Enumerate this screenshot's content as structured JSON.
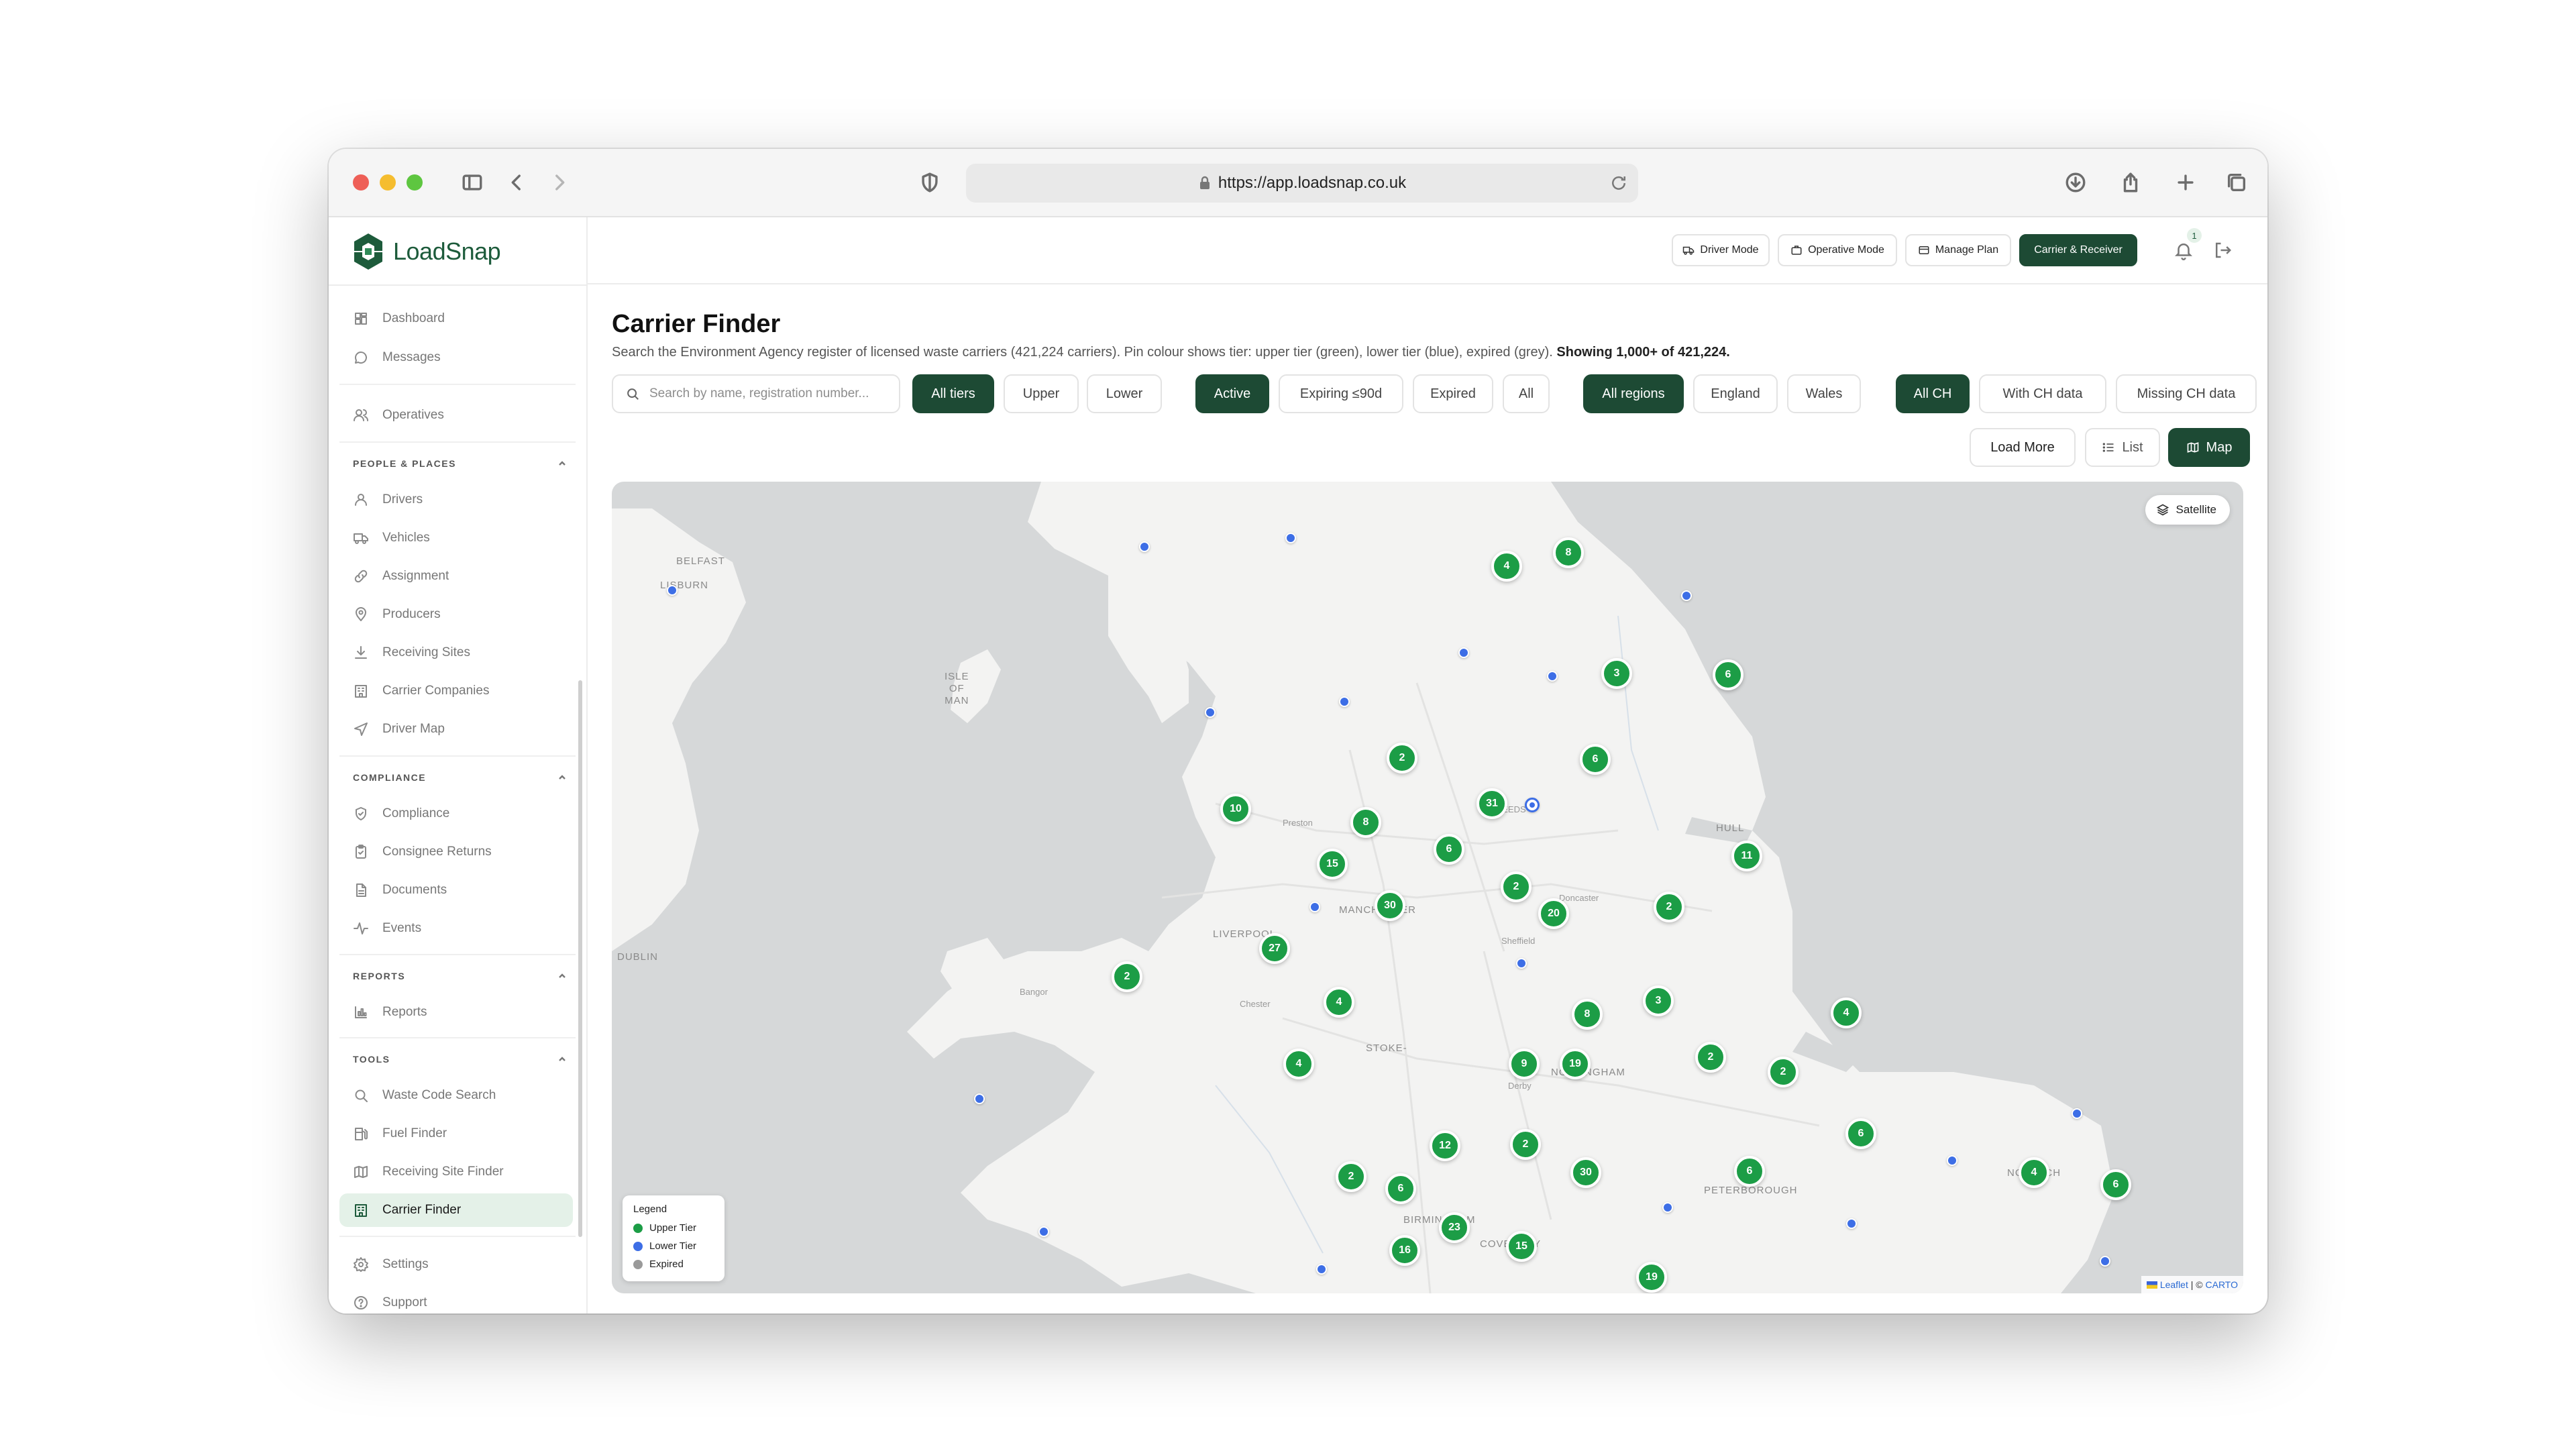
{
  "browser": {
    "url": "https://app.loadsnap.co.uk"
  },
  "brand": {
    "name": "LoadSnap"
  },
  "sidebar": {
    "top_items": [
      {
        "label": "Dashboard",
        "icon": "dashboard-icon"
      },
      {
        "label": "Messages",
        "icon": "message-icon"
      },
      {
        "label": "Operatives",
        "icon": "users-icon"
      }
    ],
    "sections": [
      {
        "title": "PEOPLE & PLACES",
        "items": [
          {
            "label": "Drivers",
            "icon": "user-icon"
          },
          {
            "label": "Vehicles",
            "icon": "truck-icon"
          },
          {
            "label": "Assignment",
            "icon": "link-icon"
          },
          {
            "label": "Producers",
            "icon": "map-pin-icon"
          },
          {
            "label": "Receiving Sites",
            "icon": "download-icon"
          },
          {
            "label": "Carrier Companies",
            "icon": "building-icon"
          },
          {
            "label": "Driver Map",
            "icon": "navigation-icon"
          }
        ]
      },
      {
        "title": "COMPLIANCE",
        "items": [
          {
            "label": "Compliance",
            "icon": "shield-icon"
          },
          {
            "label": "Consignee Returns",
            "icon": "clipboard-icon"
          },
          {
            "label": "Documents",
            "icon": "file-icon"
          },
          {
            "label": "Events",
            "icon": "activity-icon"
          }
        ]
      },
      {
        "title": "REPORTS",
        "items": [
          {
            "label": "Reports",
            "icon": "bar-chart-icon"
          }
        ]
      },
      {
        "title": "TOOLS",
        "items": [
          {
            "label": "Waste Code Search",
            "icon": "search-icon"
          },
          {
            "label": "Fuel Finder",
            "icon": "fuel-icon"
          },
          {
            "label": "Receiving Site Finder",
            "icon": "map-icon"
          },
          {
            "label": "Carrier Finder",
            "icon": "building-icon",
            "active": true
          }
        ]
      }
    ],
    "bottom_items": [
      {
        "label": "Settings",
        "icon": "gear-icon"
      },
      {
        "label": "Support",
        "icon": "help-icon"
      }
    ]
  },
  "topbar": {
    "driver_mode": "Driver Mode",
    "operative_mode": "Operative Mode",
    "manage_plan": "Manage Plan",
    "carrier_receiver": "Carrier & Receiver",
    "notification_count": "1"
  },
  "page": {
    "title": "Carrier Finder",
    "subtitle": "Search the Environment Agency register of licensed waste carriers (421,224 carriers). Pin colour shows tier: upper tier (green), lower tier (blue), expired (grey).",
    "subtitle_showing": "Showing 1,000+ of 421,224.",
    "search_placeholder": "Search by name, registration number..."
  },
  "filters": {
    "tier": [
      "All tiers",
      "Upper",
      "Lower"
    ],
    "tier_selected": "All tiers",
    "status": [
      "Active",
      "Expiring ≤90d",
      "Expired",
      "All"
    ],
    "status_selected": "Active",
    "region": [
      "All regions",
      "England",
      "Wales"
    ],
    "region_selected": "All regions",
    "ch": [
      "All CH",
      "With CH data",
      "Missing CH data"
    ],
    "ch_selected": "All CH"
  },
  "actions": {
    "load_more": "Load More",
    "list": "List",
    "map": "Map",
    "view_selected": "Map"
  },
  "map": {
    "satellite_label": "Satellite",
    "legend": {
      "title": "Legend",
      "items": [
        {
          "label": "Upper Tier",
          "color": "#1c9d46"
        },
        {
          "label": "Lower Tier",
          "color": "#3d6ee6"
        },
        {
          "label": "Expired",
          "color": "#9a9a9a"
        }
      ]
    },
    "attribution": {
      "leaflet": "Leaflet",
      "separator": " | © ",
      "carto": "CARTO"
    },
    "place_labels": {
      "belfast": "BELFAST",
      "lisburn": "LISBURN",
      "isle_of_man": "ISLE\nOF\nMAN",
      "dublin": "DUBLIN",
      "preston": "Preston",
      "leeds": "LEEDS",
      "hull": "HULL",
      "manchester": "MANCHESTER",
      "doncaster": "Doncaster",
      "sheffield": "Sheffield",
      "liverpool": "LIVERPOOL",
      "bangor": "Bangor",
      "chester": "Chester",
      "stoke": "STOKE-",
      "nottingham": "NOTTINGHAM",
      "derby": "Derby",
      "peterborough": "PETERBOROUGH",
      "birmingham": "BIRMINGHAM",
      "coventry": "COVENTRY",
      "norwich": "NORWICH"
    },
    "clusters": [
      "4",
      "8",
      "3",
      "6",
      "2",
      "6",
      "10",
      "8",
      "31",
      "6",
      "11",
      "15",
      "2",
      "30",
      "20",
      "2",
      "27",
      "2",
      "4",
      "3",
      "4",
      "8",
      "9",
      "19",
      "2",
      "2",
      "4",
      "6",
      "12",
      "2",
      "30",
      "6",
      "4",
      "6",
      "2",
      "6",
      "23",
      "16",
      "15",
      "19"
    ]
  }
}
